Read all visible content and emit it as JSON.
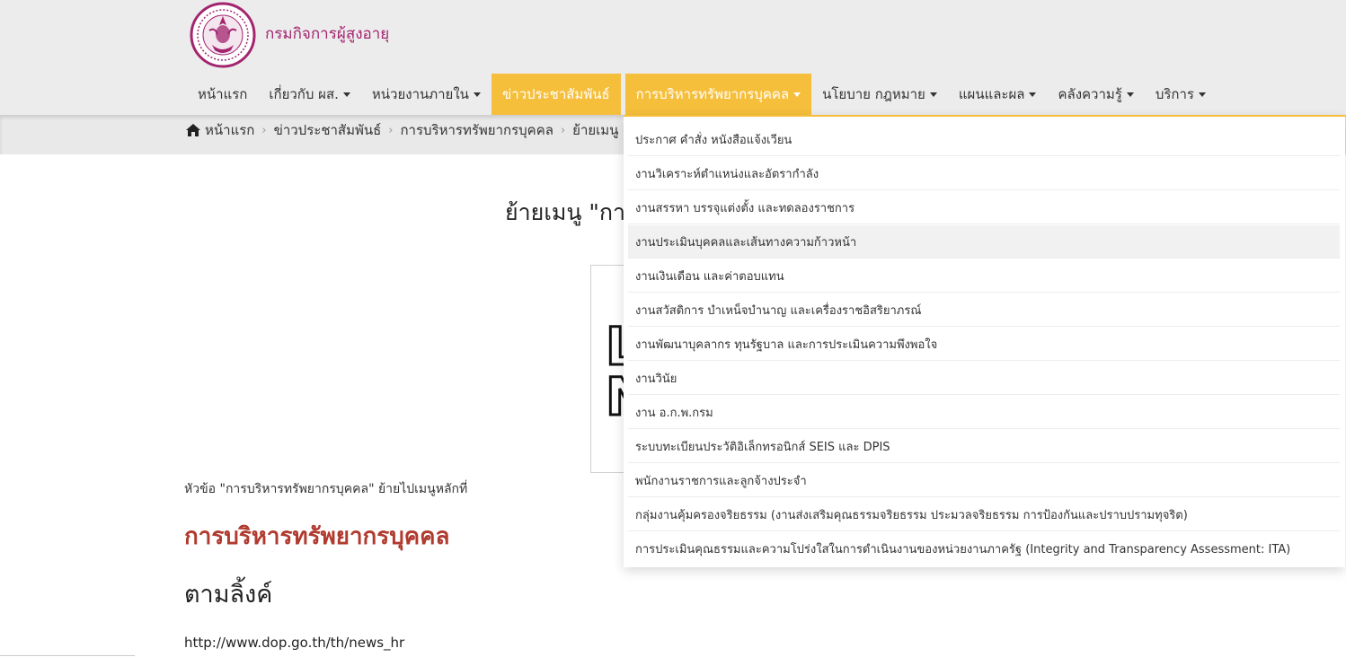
{
  "header": {
    "site_name": "กรมกิจการผู้สูงอายุ"
  },
  "nav": {
    "items": [
      {
        "label": "หน้าแรก"
      },
      {
        "label": "เกี่ยวกับ ผส."
      },
      {
        "label": "หน่วยงานภายใน"
      },
      {
        "label": "ข่าวประชาสัมพันธ์"
      },
      {
        "label": "การบริหารทรัพยากรบุคคล"
      },
      {
        "label": "นโยบาย กฎหมาย"
      },
      {
        "label": "แผนและผล"
      },
      {
        "label": "คลังความรู้"
      },
      {
        "label": "บริการ"
      }
    ]
  },
  "breadcrumb": {
    "items": [
      "หน้าแรก",
      "ข่าวประชาสัมพันธ์",
      "การบริหารทรัพยากรบุคคล",
      "ย้ายเมนู \""
    ]
  },
  "dropdown": {
    "items": [
      "ประกาศ คำสั่ง หนังสือแจ้งเวียน",
      "งานวิเคราะห์ตำแหน่งและอัตรากำลัง",
      "งานสรรหา บรรจุแต่งตั้ง และทดลองราชการ",
      "งานประเมินบุคคลและเส้นทางความก้าวหน้า",
      "งานเงินเดือน และค่าตอบแทน",
      "งานสวัสดิการ บำเหน็จบำนาญ และเครื่องราชอิสริยาภรณ์",
      "งานพัฒนาบุคลากร ทุนรัฐบาล และการประเมินความพึงพอใจ",
      "งานวินัย",
      "งาน อ.ก.พ.กรม",
      "ระบบทะเบียนประวัติอิเล็กทรอนิกส์ SEIS และ DPIS",
      "พนักงานราชการและลูกจ้างประจำ",
      "กลุ่มงานคุ้มครองจริยธรรม (งานส่งเสริมคุณธรรมจริยธรรม ประมวลจริยธรรม การป้องกันและปราบปรามทุจริต)",
      "การประเมินคุณธรรมและความโปร่งใสในการดำเนินงานของหน่วยงานภาครัฐ (Integrity and Transparency Assessment: ITA)"
    ]
  },
  "content": {
    "title": "ย้ายเมนู \"กา",
    "image_fragment": "L\nN",
    "body_text": "หัวข้อ \"การบริหารทรัพยากรบุคคล\" ย้ายไปเมนูหลักที่",
    "red_heading": "การบริหารทรัพยากรบุคคล",
    "follow_link": "ตามลิ้งค์",
    "url": "http://www.dop.go.th/th/news_hr"
  },
  "colors": {
    "brand_magenta": "#a3246f",
    "accent_gold": "#f5bf3c",
    "heading_red": "#b13a2e"
  }
}
